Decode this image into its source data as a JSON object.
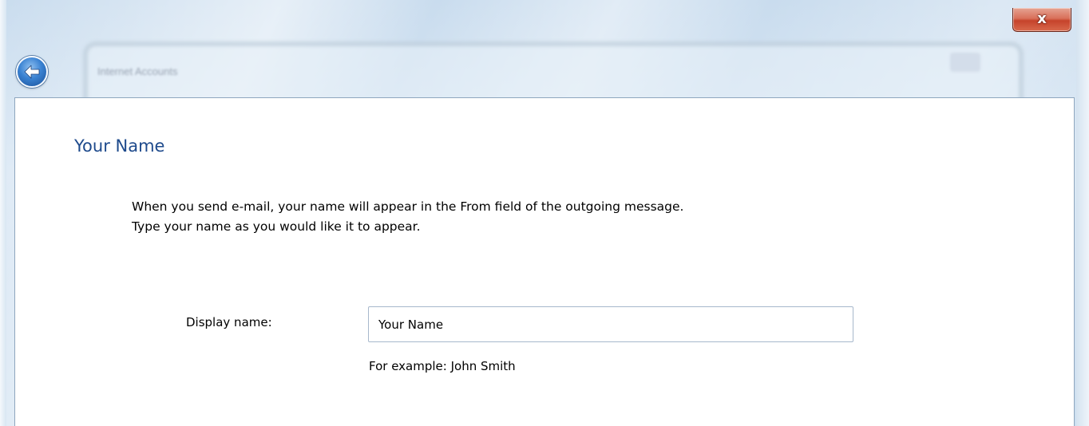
{
  "window": {
    "background_title": "Internet Accounts"
  },
  "header": {
    "close_label": "x",
    "back_icon": "back-arrow-icon"
  },
  "page": {
    "title": "Your Name",
    "instructions": [
      "When you send e-mail, your name will appear in the From field of the outgoing message.",
      "Type your name as you would like it to appear."
    ],
    "display_name_label": "Display name:",
    "display_name_value": "Your Name",
    "example_text": "For example: John Smith"
  },
  "colors": {
    "title": "#1e4a8c",
    "close_button": "#c6432b",
    "back_button": "#3a82d2"
  }
}
